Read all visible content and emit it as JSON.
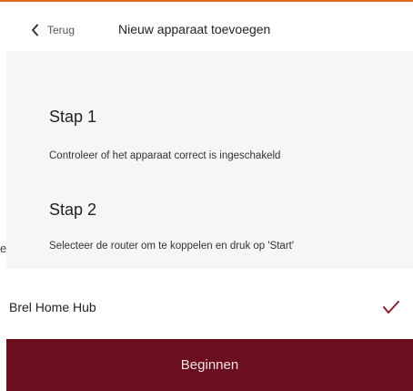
{
  "colors": {
    "accent": "#e06a1a",
    "brand": "#6b0f1f",
    "check": "#8a1c2c"
  },
  "header": {
    "back_label": "Terug",
    "back_icon": "chevron-left-icon",
    "title": "Nieuw apparaat toevoegen"
  },
  "steps": [
    {
      "title": "Stap 1",
      "description": "Controleer of het apparaat correct is ingeschakeld"
    },
    {
      "title": "Stap 2",
      "description": "Selecteer de router om te koppelen en druk op 'Start'"
    }
  ],
  "edge_fragment": "e",
  "device": {
    "name": "Brel Home Hub",
    "selected_icon": "checkmark-icon"
  },
  "start_button": {
    "label": "Beginnen"
  }
}
